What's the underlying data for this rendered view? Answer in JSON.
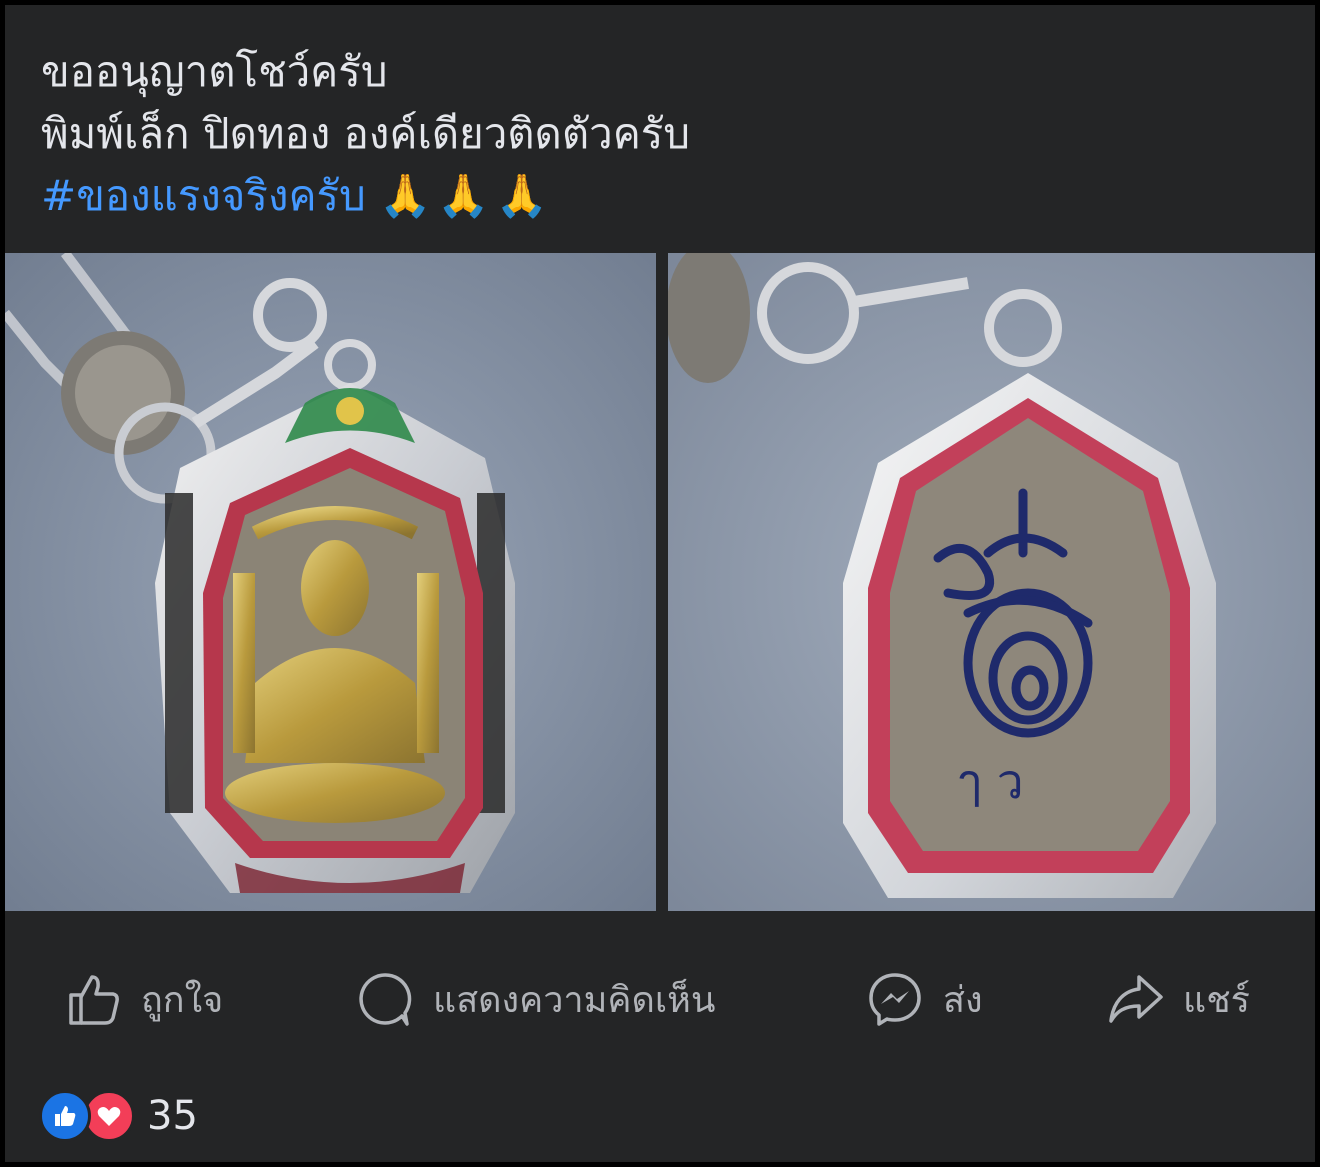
{
  "post": {
    "line1": "ขออนุญาตโชว์ครับ",
    "line2": "พิมพ์เล็ก ปิดทอง องค์เดียวติดตัวครับ",
    "hashtag": "#ของแรงจริงครับ",
    "emoji": "🙏🙏🙏"
  },
  "photos": {
    "left_icon": "amulet-front-photo",
    "right_icon": "amulet-back-photo",
    "back_inscription": "ๅ ว"
  },
  "actions": {
    "like_label": "ถูกใจ",
    "comment_label": "แสดงความคิดเห็น",
    "send_label": "ส่ง",
    "share_label": "แชร์"
  },
  "reactions": {
    "count": "35",
    "like_color": "#1b74e4",
    "love_color": "#f33e58"
  },
  "colors": {
    "background": "#242526",
    "text": "#e4e6eb",
    "muted": "#b0b3b8",
    "hashtag": "#4599ff"
  }
}
